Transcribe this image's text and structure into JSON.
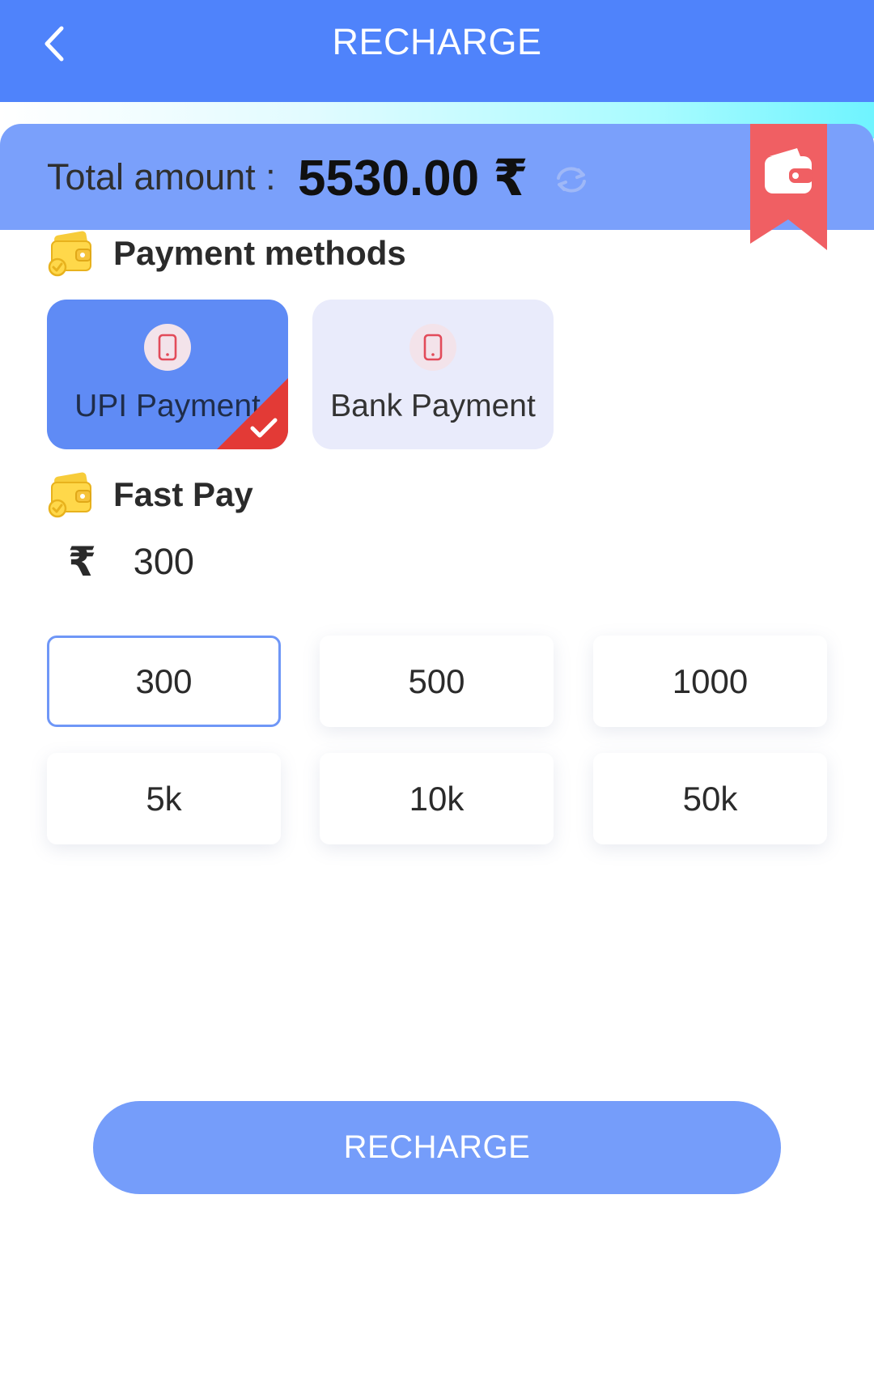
{
  "header": {
    "title": "RECHARGE",
    "back_icon": "chevron-left-icon"
  },
  "balance": {
    "label": "Total amount :",
    "value": "5530.00 ₹",
    "refresh_icon": "refresh-icon",
    "wallet_icon": "wallet-icon"
  },
  "payment_methods": {
    "title": "Payment methods",
    "options": [
      {
        "label": "UPI Payment",
        "icon": "phone-icon",
        "selected": true
      },
      {
        "label": "Bank Payment",
        "icon": "phone-icon",
        "selected": false
      }
    ]
  },
  "fast_pay": {
    "title": "Fast Pay",
    "currency": "₹",
    "amount": "300",
    "quick_amounts": [
      "300",
      "500",
      "1000",
      "5k",
      "10k",
      "50k"
    ],
    "selected_index": 0
  },
  "action": {
    "label": "RECHARGE"
  },
  "colors": {
    "header": "#4f83fb",
    "balance_card": "#7aa0fb",
    "bookmark": "#f05f63",
    "selected_card": "#5f8bf5",
    "button": "#759dfa"
  }
}
